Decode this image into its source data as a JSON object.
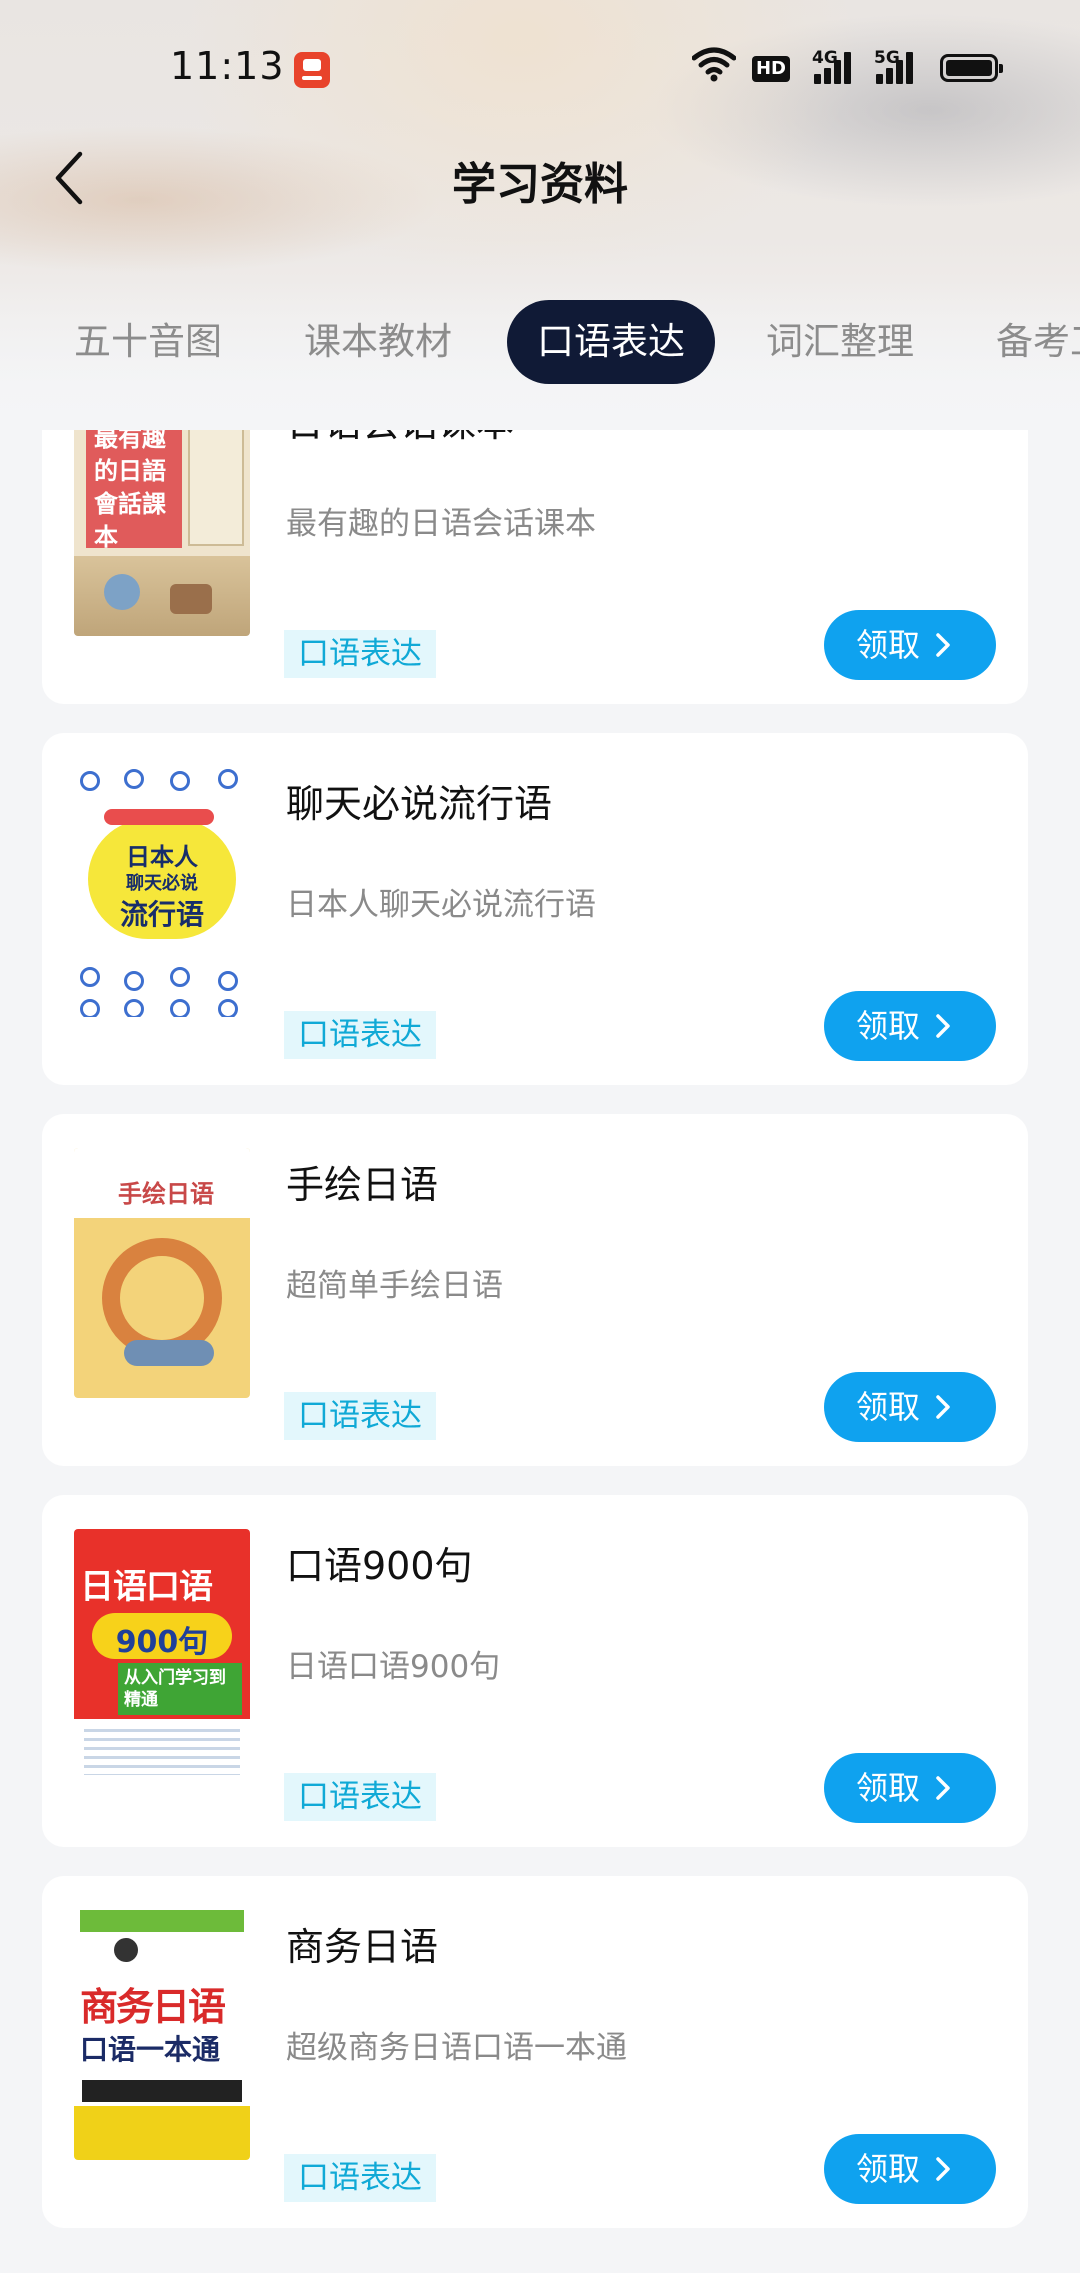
{
  "status_bar": {
    "time": "11:13",
    "hd_label": "HD",
    "signal_1_label": "4G",
    "signal_2_label": "5G"
  },
  "nav": {
    "title": "学习资料"
  },
  "tabs": [
    {
      "label": "五十音图",
      "active": false
    },
    {
      "label": "课本教材",
      "active": false
    },
    {
      "label": "口语表达",
      "active": true
    },
    {
      "label": "词汇整理",
      "active": false
    },
    {
      "label": "备考工具",
      "active": false
    }
  ],
  "items": [
    {
      "title": "日语会话课本",
      "description": "最有趣的日语会话课本",
      "tag": "口语表达",
      "button": "领取",
      "cover_text": "最有趣的日語會話課本"
    },
    {
      "title": "聊天必说流行语",
      "description": "日本人聊天必说流行语",
      "tag": "口语表达",
      "button": "领取",
      "cover_text_1": "日本人",
      "cover_text_2": "聊天必说",
      "cover_text_3": "流行语"
    },
    {
      "title": "手绘日语",
      "description": "超简单手绘日语",
      "tag": "口语表达",
      "button": "领取",
      "cover_text": "手绘日语"
    },
    {
      "title": "口语900句",
      "description": "日语口语900句",
      "tag": "口语表达",
      "button": "领取",
      "cover_text_1": "日语口语",
      "cover_text_2": "900句",
      "cover_text_3": "从入门学习到精通"
    },
    {
      "title": "商务日语",
      "description": "超级商务日语口语一本通",
      "tag": "口语表达",
      "button": "领取",
      "cover_text_1": "商务日语",
      "cover_text_2": "口语一本通"
    }
  ],
  "colors": {
    "active_tab_bg": "#101a36",
    "button_bg": "#0fa2ef",
    "tag_bg": "#e3f7fc",
    "tag_text": "#10a9d6"
  }
}
